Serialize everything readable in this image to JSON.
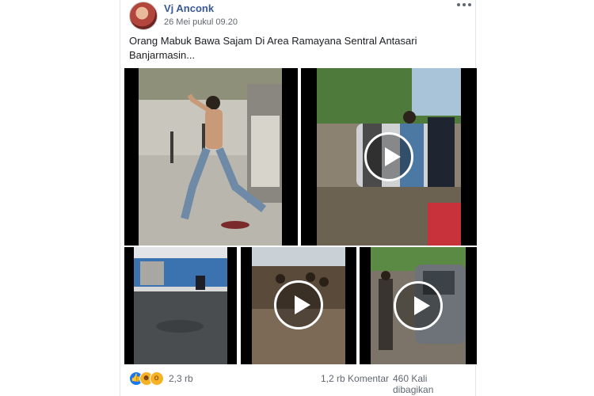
{
  "post": {
    "author": "Vj Anconk",
    "timestamp": "26 Mei pukul 09.20",
    "text": "Orang Mabuk Bawa Sajam Di Area Ramayana Sentral Antasari Banjarmasin..."
  },
  "media": [
    {
      "kind": "photo",
      "has_play": false
    },
    {
      "kind": "video",
      "has_play": true
    },
    {
      "kind": "photo",
      "has_play": false
    },
    {
      "kind": "video",
      "has_play": true
    },
    {
      "kind": "video",
      "has_play": true
    }
  ],
  "footer": {
    "reaction_icons": [
      "like-icon",
      "haha-icon",
      "wow-icon"
    ],
    "reaction_count": "2,3 rb",
    "comments": "1,2 rb Komentar",
    "shares": "460 Kali dibagikan"
  },
  "colors": {
    "author_link": "#385898",
    "meta_text": "#616770",
    "like_blue": "#1877f2"
  }
}
